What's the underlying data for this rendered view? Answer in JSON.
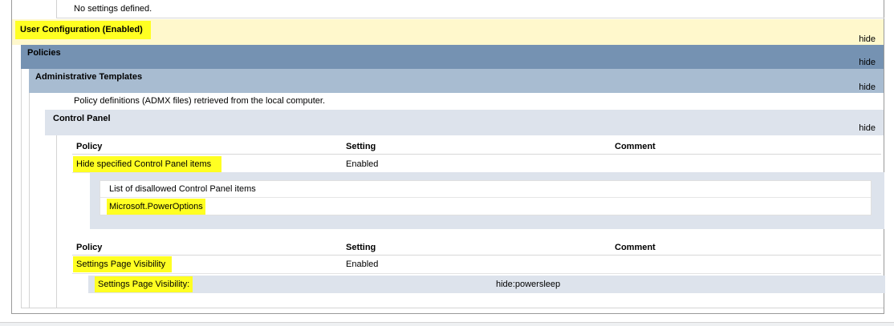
{
  "top_section": {
    "no_settings_text": "No settings defined."
  },
  "user_config": {
    "title": "User Configuration (Enabled)",
    "hide_label": "hide"
  },
  "policies": {
    "title": "Policies",
    "hide_label": "hide"
  },
  "admin_templates": {
    "title": "Administrative Templates",
    "hide_label": "hide",
    "description": "Policy definitions (ADMX files) retrieved from the local computer."
  },
  "control_panel": {
    "title": "Control Panel",
    "hide_label": "hide"
  },
  "table_headers": {
    "policy": "Policy",
    "setting": "Setting",
    "comment": "Comment"
  },
  "policy_hide_items": {
    "name": "Hide specified Control Panel items",
    "setting": "Enabled",
    "list_header": "List of disallowed Control Panel items",
    "list_items": [
      "Microsoft.PowerOptions"
    ]
  },
  "policy_settings_visibility": {
    "name": "Settings Page Visibility",
    "setting": "Enabled",
    "detail_label": "Settings Page Visibility:",
    "detail_value": "hide:powersleep"
  },
  "colors": {
    "user_config_bg": "#fff8cc",
    "policies_bg": "#7592b2",
    "admin_templates_bg": "#a8bcd1",
    "control_panel_bg": "#dde3ec",
    "highlight": "#ffff22"
  }
}
